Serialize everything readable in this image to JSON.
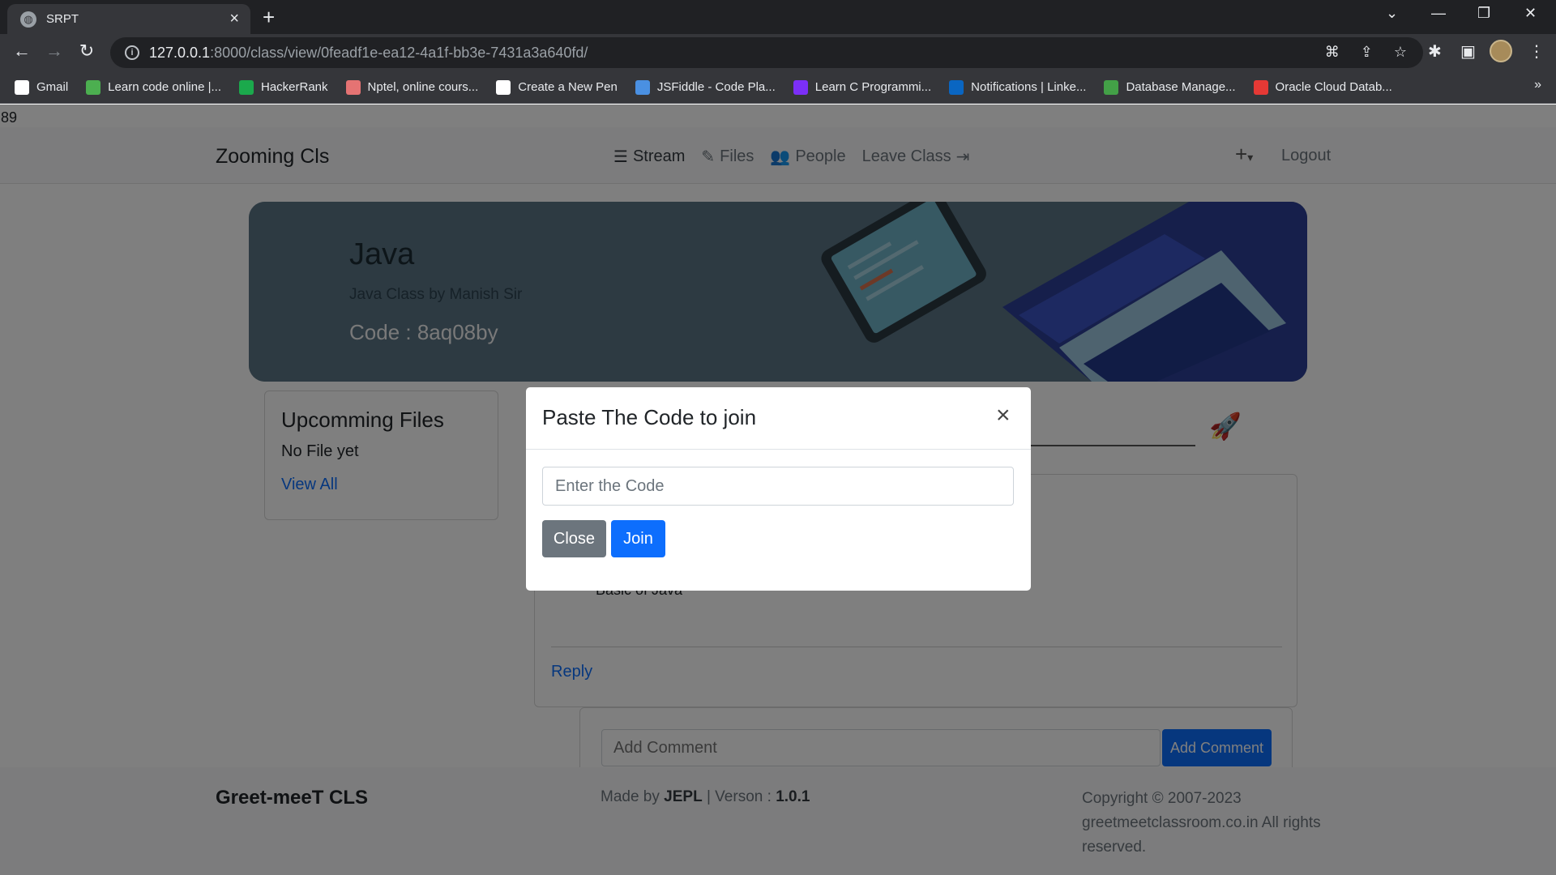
{
  "browser": {
    "tab_title": "SRPT",
    "url_host": "127.0.0.1",
    "url_path": ":8000/class/view/0feadf1e-ea12-4a1f-bb3e-7431a3a640fd/",
    "bookmarks": [
      {
        "label": "Gmail",
        "icon": "google-icon",
        "color": "#ffffff"
      },
      {
        "label": "Learn code online |...",
        "icon": "code-icon",
        "color": "#4caf50"
      },
      {
        "label": "HackerRank",
        "icon": "hackerrank-icon",
        "color": "#1ba94c"
      },
      {
        "label": "Nptel, online cours...",
        "icon": "nptel-icon",
        "color": "#e57373"
      },
      {
        "label": "Create a New Pen",
        "icon": "codepen-icon",
        "color": "#ffffff"
      },
      {
        "label": "JSFiddle - Code Pla...",
        "icon": "jsfiddle-icon",
        "color": "#4a90e2"
      },
      {
        "label": "Learn C Programmi...",
        "icon": "programiz-icon",
        "color": "#7b2ff7"
      },
      {
        "label": "Notifications | Linke...",
        "icon": "linkedin-icon",
        "color": "#0a66c2"
      },
      {
        "label": "Database Manage...",
        "icon": "database-icon",
        "color": "#43a047"
      },
      {
        "label": "Oracle Cloud Datab...",
        "icon": "oracle-icon",
        "color": "#e53935"
      }
    ],
    "more_label": "»"
  },
  "page": {
    "debug_number": "89",
    "brand": "Zooming Cls",
    "nav": {
      "stream": "Stream",
      "files": "Files",
      "people": "People",
      "leave": "Leave Class"
    },
    "plus": "+",
    "logout": "Logout",
    "banner": {
      "title": "Java",
      "subtitle": "Java Class by Manish Sir",
      "code": "Code : 8aq08by"
    },
    "upcoming": {
      "title": "Upcomming Files",
      "empty": "No File yet",
      "view_all": "View All"
    },
    "post": {
      "text": "Basic of Java",
      "reply": "Reply"
    },
    "comment": {
      "placeholder": "Add Comment",
      "button": "Add Comment"
    },
    "footer": {
      "brand": "Greet-meeT CLS",
      "made_prefix": "Made by",
      "made_by": "JEPL",
      "version_prefix": "| Verson :",
      "version": "1.0.1",
      "copyright": "Copyright © 2007-2023 greetmeetclassroom.co.in All rights reserved."
    }
  },
  "modal": {
    "title": "Paste The Code to join",
    "close_symbol": "×",
    "input_placeholder": "Enter the Code",
    "close_button": "Close",
    "join_button": "Join"
  },
  "colors": {
    "primary": "#0d6efd",
    "secondary": "#6c757d",
    "chrome_dark": "#202124",
    "chrome": "#35363a"
  }
}
